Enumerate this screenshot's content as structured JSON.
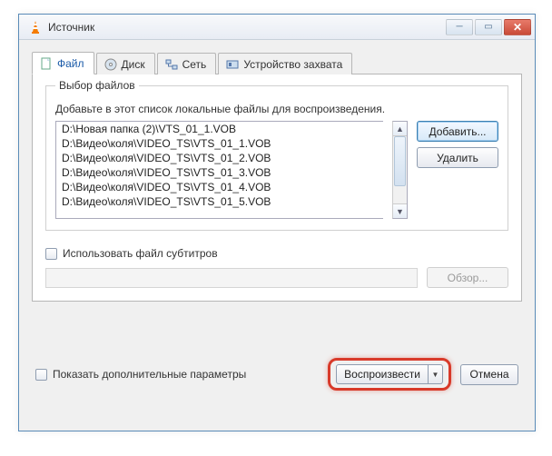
{
  "window": {
    "title": "Источник"
  },
  "tabs": {
    "file": "Файл",
    "disc": "Диск",
    "network": "Сеть",
    "capture": "Устройство захвата"
  },
  "fileGroup": {
    "title": "Выбор файлов",
    "desc": "Добавьте в этот список локальные файлы для воспроизведения.",
    "items": [
      "D:\\Новая папка (2)\\VTS_01_1.VOB",
      "D:\\Видео\\коля\\VIDEO_TS\\VTS_01_1.VOB",
      "D:\\Видео\\коля\\VIDEO_TS\\VTS_01_2.VOB",
      "D:\\Видео\\коля\\VIDEO_TS\\VTS_01_3.VOB",
      "D:\\Видео\\коля\\VIDEO_TS\\VTS_01_4.VOB",
      "D:\\Видео\\коля\\VIDEO_TS\\VTS_01_5.VOB"
    ],
    "addBtn": "Добавить...",
    "removeBtn": "Удалить"
  },
  "subtitle": {
    "checkbox": "Использовать файл субтитров",
    "browse": "Обзор..."
  },
  "advanced": "Показать дополнительные параметры",
  "playBtn": "Воспроизвести",
  "cancelBtn": "Отмена"
}
